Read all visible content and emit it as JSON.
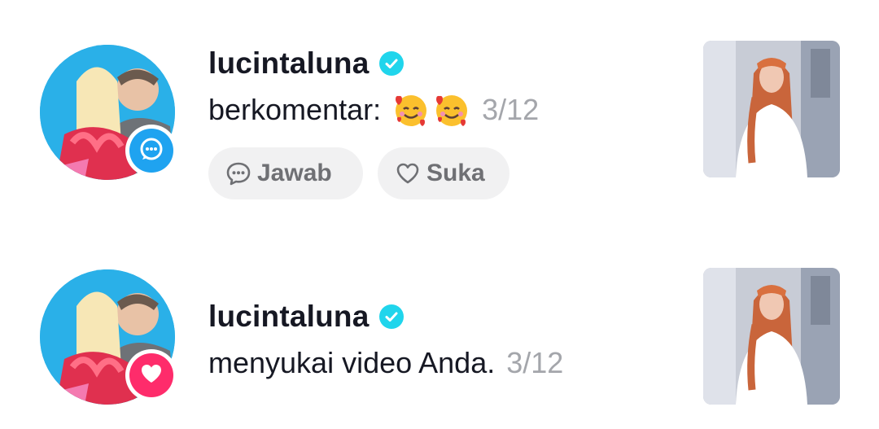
{
  "notifications": [
    {
      "username": "lucintaluna",
      "verified": true,
      "message": "berkomentar:",
      "emojis": [
        "smiling-face-with-hearts",
        "smiling-face-with-hearts"
      ],
      "date": "3/12",
      "badge_icon": "comment-icon",
      "actions": {
        "reply_label": "Jawab",
        "like_label": "Suka"
      }
    },
    {
      "username": "lucintaluna",
      "verified": true,
      "message": "menyukai video Anda.",
      "date": "3/12",
      "badge_icon": "heart-icon"
    }
  ],
  "colors": {
    "verified": "#20d5ec",
    "comment_badge": "#1fa3f0",
    "like_badge": "#fe2c6b",
    "date_text": "#a4a6ab",
    "pill_bg": "#f1f1f2"
  }
}
